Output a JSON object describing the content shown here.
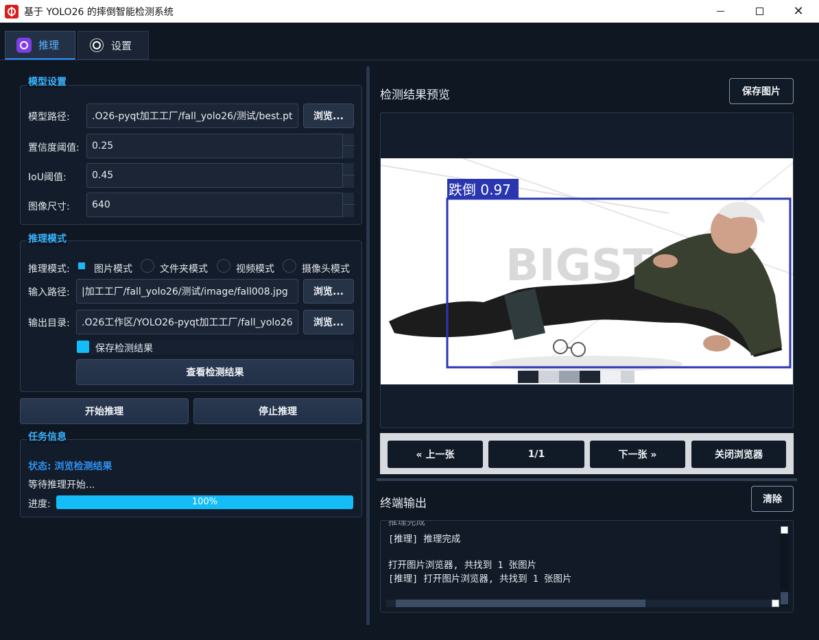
{
  "window": {
    "title": "基于 YOLO26 的摔倒智能检测系统"
  },
  "tabs": [
    {
      "label": "推理"
    },
    {
      "label": "设置"
    }
  ],
  "model_settings": {
    "title": "模型设置",
    "model_path_label": "模型路径:",
    "model_path_value": ".O26-pyqt加工工厂/fall_yolo26/测试/best.pt",
    "browse_label": "浏览...",
    "conf_label": "置信度阈值:",
    "conf_value": "0.25",
    "iou_label": "IoU阈值:",
    "iou_value": "0.45",
    "imgsz_label": "图像尺寸:",
    "imgsz_value": "640"
  },
  "inference_mode": {
    "title": "推理模式",
    "mode_label": "推理模式:",
    "modes": [
      "图片模式",
      "文件夹模式",
      "视频模式",
      "摄像头模式"
    ],
    "selected_mode": "图片模式",
    "input_label": "输入路径:",
    "input_value": "|加工工厂/fall_yolo26/测试/image/fall008.jpg",
    "output_label": "输出目录:",
    "output_value": ".O26工作区/YOLO26-pyqt加工工厂/fall_yolo26",
    "browse_label": "浏览...",
    "save_results_label": "保存检测结果",
    "save_results_checked": true,
    "view_results_label": "查看检测结果"
  },
  "actions": {
    "start_label": "开始推理",
    "stop_label": "停止推理"
  },
  "task_info": {
    "title": "任务信息",
    "status_text": "状态: 浏览检测结果",
    "message": "等待推理开始...",
    "progress_label": "进度:",
    "progress_value": 100,
    "progress_text": "100%"
  },
  "preview": {
    "title": "检测结果预览",
    "save_image_label": "保存图片",
    "detection_label": "跌倒 0.97",
    "watermark": "BIGSTOCK",
    "nav": {
      "prev_label": "« 上一张",
      "page_label": "1/1",
      "next_label": "下一张 »",
      "close_label": "关闭浏览器"
    }
  },
  "terminal": {
    "title": "终端输出",
    "clear_label": "清除",
    "lines": [
      "推理完成",
      "[推理] 推理完成",
      "",
      "打开图片浏览器, 共找到 1 张图片",
      "[推理] 打开图片浏览器, 共找到 1 张图片"
    ]
  },
  "colors": {
    "accent": "#39b3ff",
    "progress": "#14bdf7",
    "background": "#0f1722",
    "detection_box": "#2a36b0"
  }
}
